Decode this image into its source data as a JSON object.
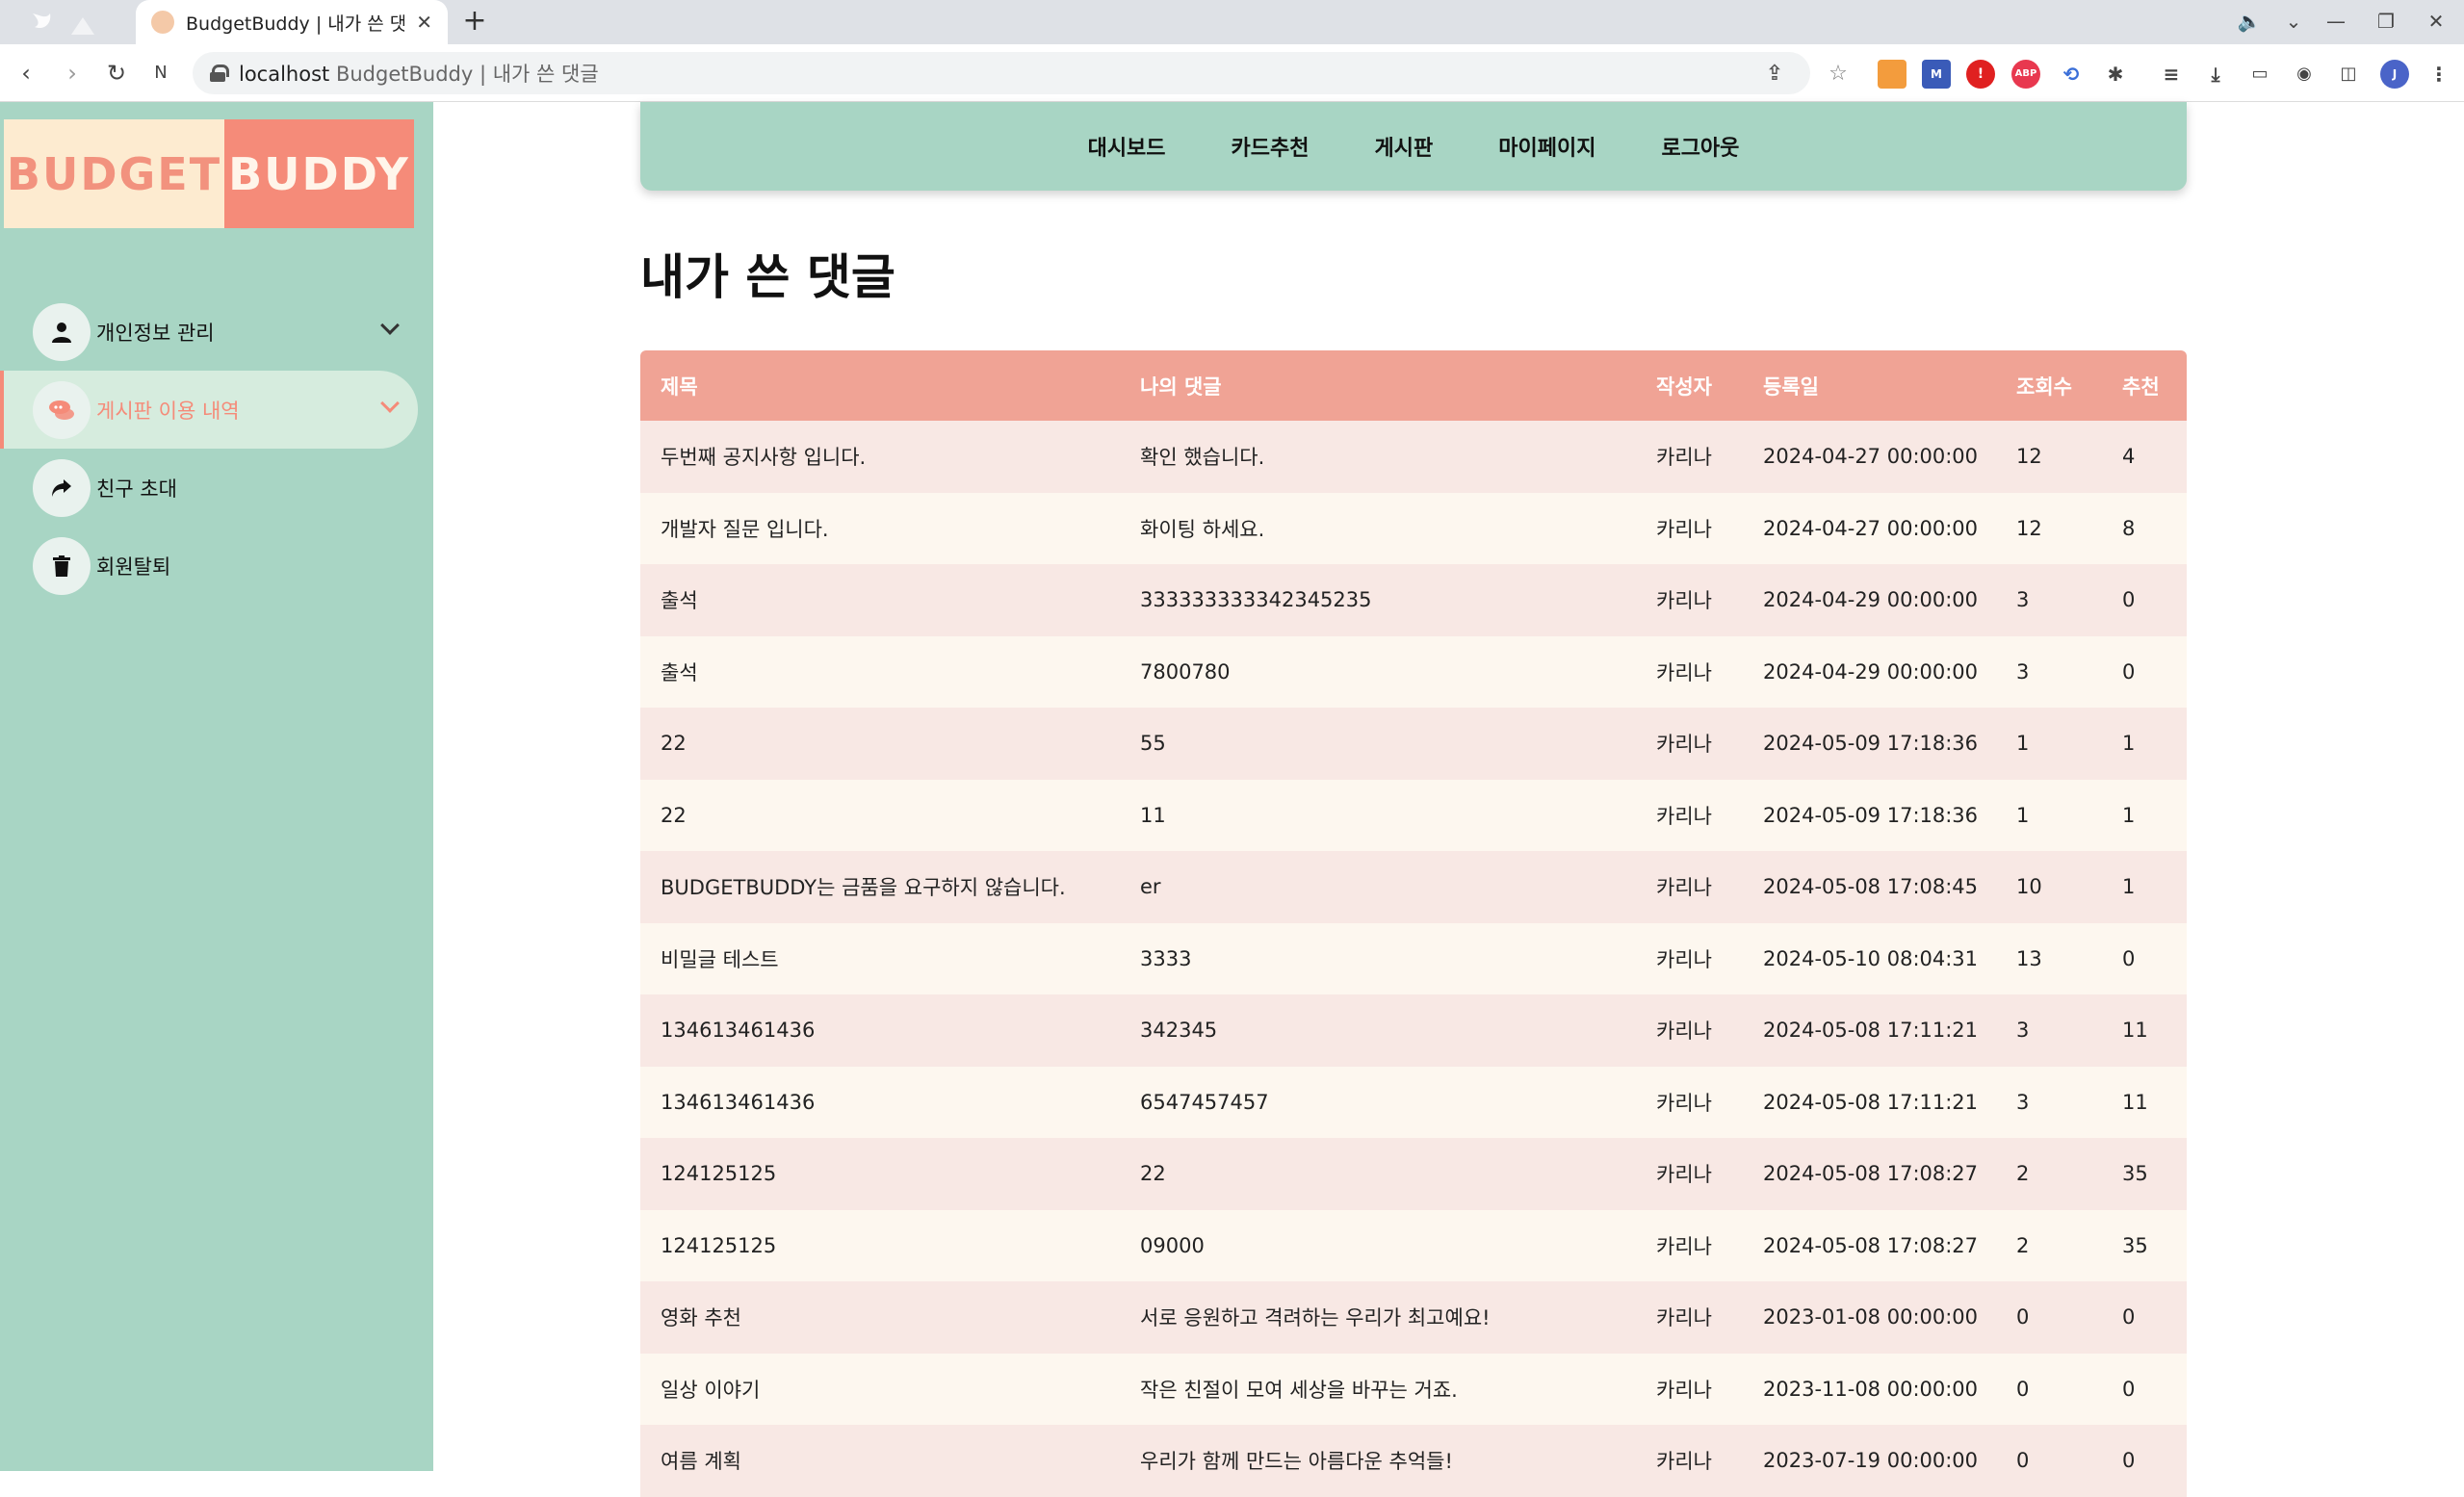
{
  "browser": {
    "tab_title": "BudgetBuddy | 내가 쓴 댓글",
    "tab_close": "✕",
    "new_tab": "+",
    "url_host": "localhost",
    "url_rest": "BudgetBuddy | 내가 쓴 댓글"
  },
  "sidebar": {
    "logo_left": "BUDGET",
    "logo_right": "BUDDY",
    "items": [
      {
        "label": "개인정보 관리",
        "icon": "user-icon"
      },
      {
        "label": "게시판 이용 내역",
        "icon": "chat-icon"
      },
      {
        "label": "친구 초대",
        "icon": "share-icon"
      },
      {
        "label": "회원탈퇴",
        "icon": "trash-icon"
      }
    ]
  },
  "topnav": {
    "items": [
      "대시보드",
      "카드추천",
      "게시판",
      "마이페이지",
      "로그아웃"
    ]
  },
  "main": {
    "title": "내가 쓴 댓글",
    "columns": [
      "제목",
      "나의 댓글",
      "작성자",
      "등록일",
      "조회수",
      "추천"
    ],
    "rows": [
      [
        "두번째 공지사항 입니다.",
        "확인 했습니다.",
        "카리나",
        "2024-04-27 00:00:00",
        "12",
        "4"
      ],
      [
        "개발자 질문 입니다.",
        "화이팅 하세요.",
        "카리나",
        "2024-04-27 00:00:00",
        "12",
        "8"
      ],
      [
        "출석",
        "333333333342345235",
        "카리나",
        "2024-04-29 00:00:00",
        "3",
        "0"
      ],
      [
        "출석",
        "7800780",
        "카리나",
        "2024-04-29 00:00:00",
        "3",
        "0"
      ],
      [
        "22",
        "55",
        "카리나",
        "2024-05-09 17:18:36",
        "1",
        "1"
      ],
      [
        "22",
        "11",
        "카리나",
        "2024-05-09 17:18:36",
        "1",
        "1"
      ],
      [
        "BUDGETBUDDY는 금품을 요구하지 않습니다.",
        "er",
        "카리나",
        "2024-05-08 17:08:45",
        "10",
        "1"
      ],
      [
        "비밀글 테스트",
        "3333",
        "카리나",
        "2024-05-10 08:04:31",
        "13",
        "0"
      ],
      [
        "134613461436",
        "342345",
        "카리나",
        "2024-05-08 17:11:21",
        "3",
        "11"
      ],
      [
        "134613461436",
        "6547457457",
        "카리나",
        "2024-05-08 17:11:21",
        "3",
        "11"
      ],
      [
        "124125125",
        "22",
        "카리나",
        "2024-05-08 17:08:27",
        "2",
        "35"
      ],
      [
        "124125125",
        "09000",
        "카리나",
        "2024-05-08 17:08:27",
        "2",
        "35"
      ],
      [
        "영화 추천",
        "서로 응원하고 격려하는 우리가 최고예요!",
        "카리나",
        "2023-01-08 00:00:00",
        "0",
        "0"
      ],
      [
        "일상 이야기",
        "작은 친절이 모여 세상을 바꾸는 거죠.",
        "카리나",
        "2023-11-08 00:00:00",
        "0",
        "0"
      ],
      [
        "여름 계획",
        "우리가 함께 만드는 아름다운 추억들!",
        "카리나",
        "2023-07-19 00:00:00",
        "0",
        "0"
      ]
    ]
  },
  "colors": {
    "sidebar_bg": "#a8d5c4",
    "accent": "#f58b79",
    "table_header": "#f0a395",
    "row_odd": "#f8e8e4",
    "row_even": "#fdf7ef"
  }
}
